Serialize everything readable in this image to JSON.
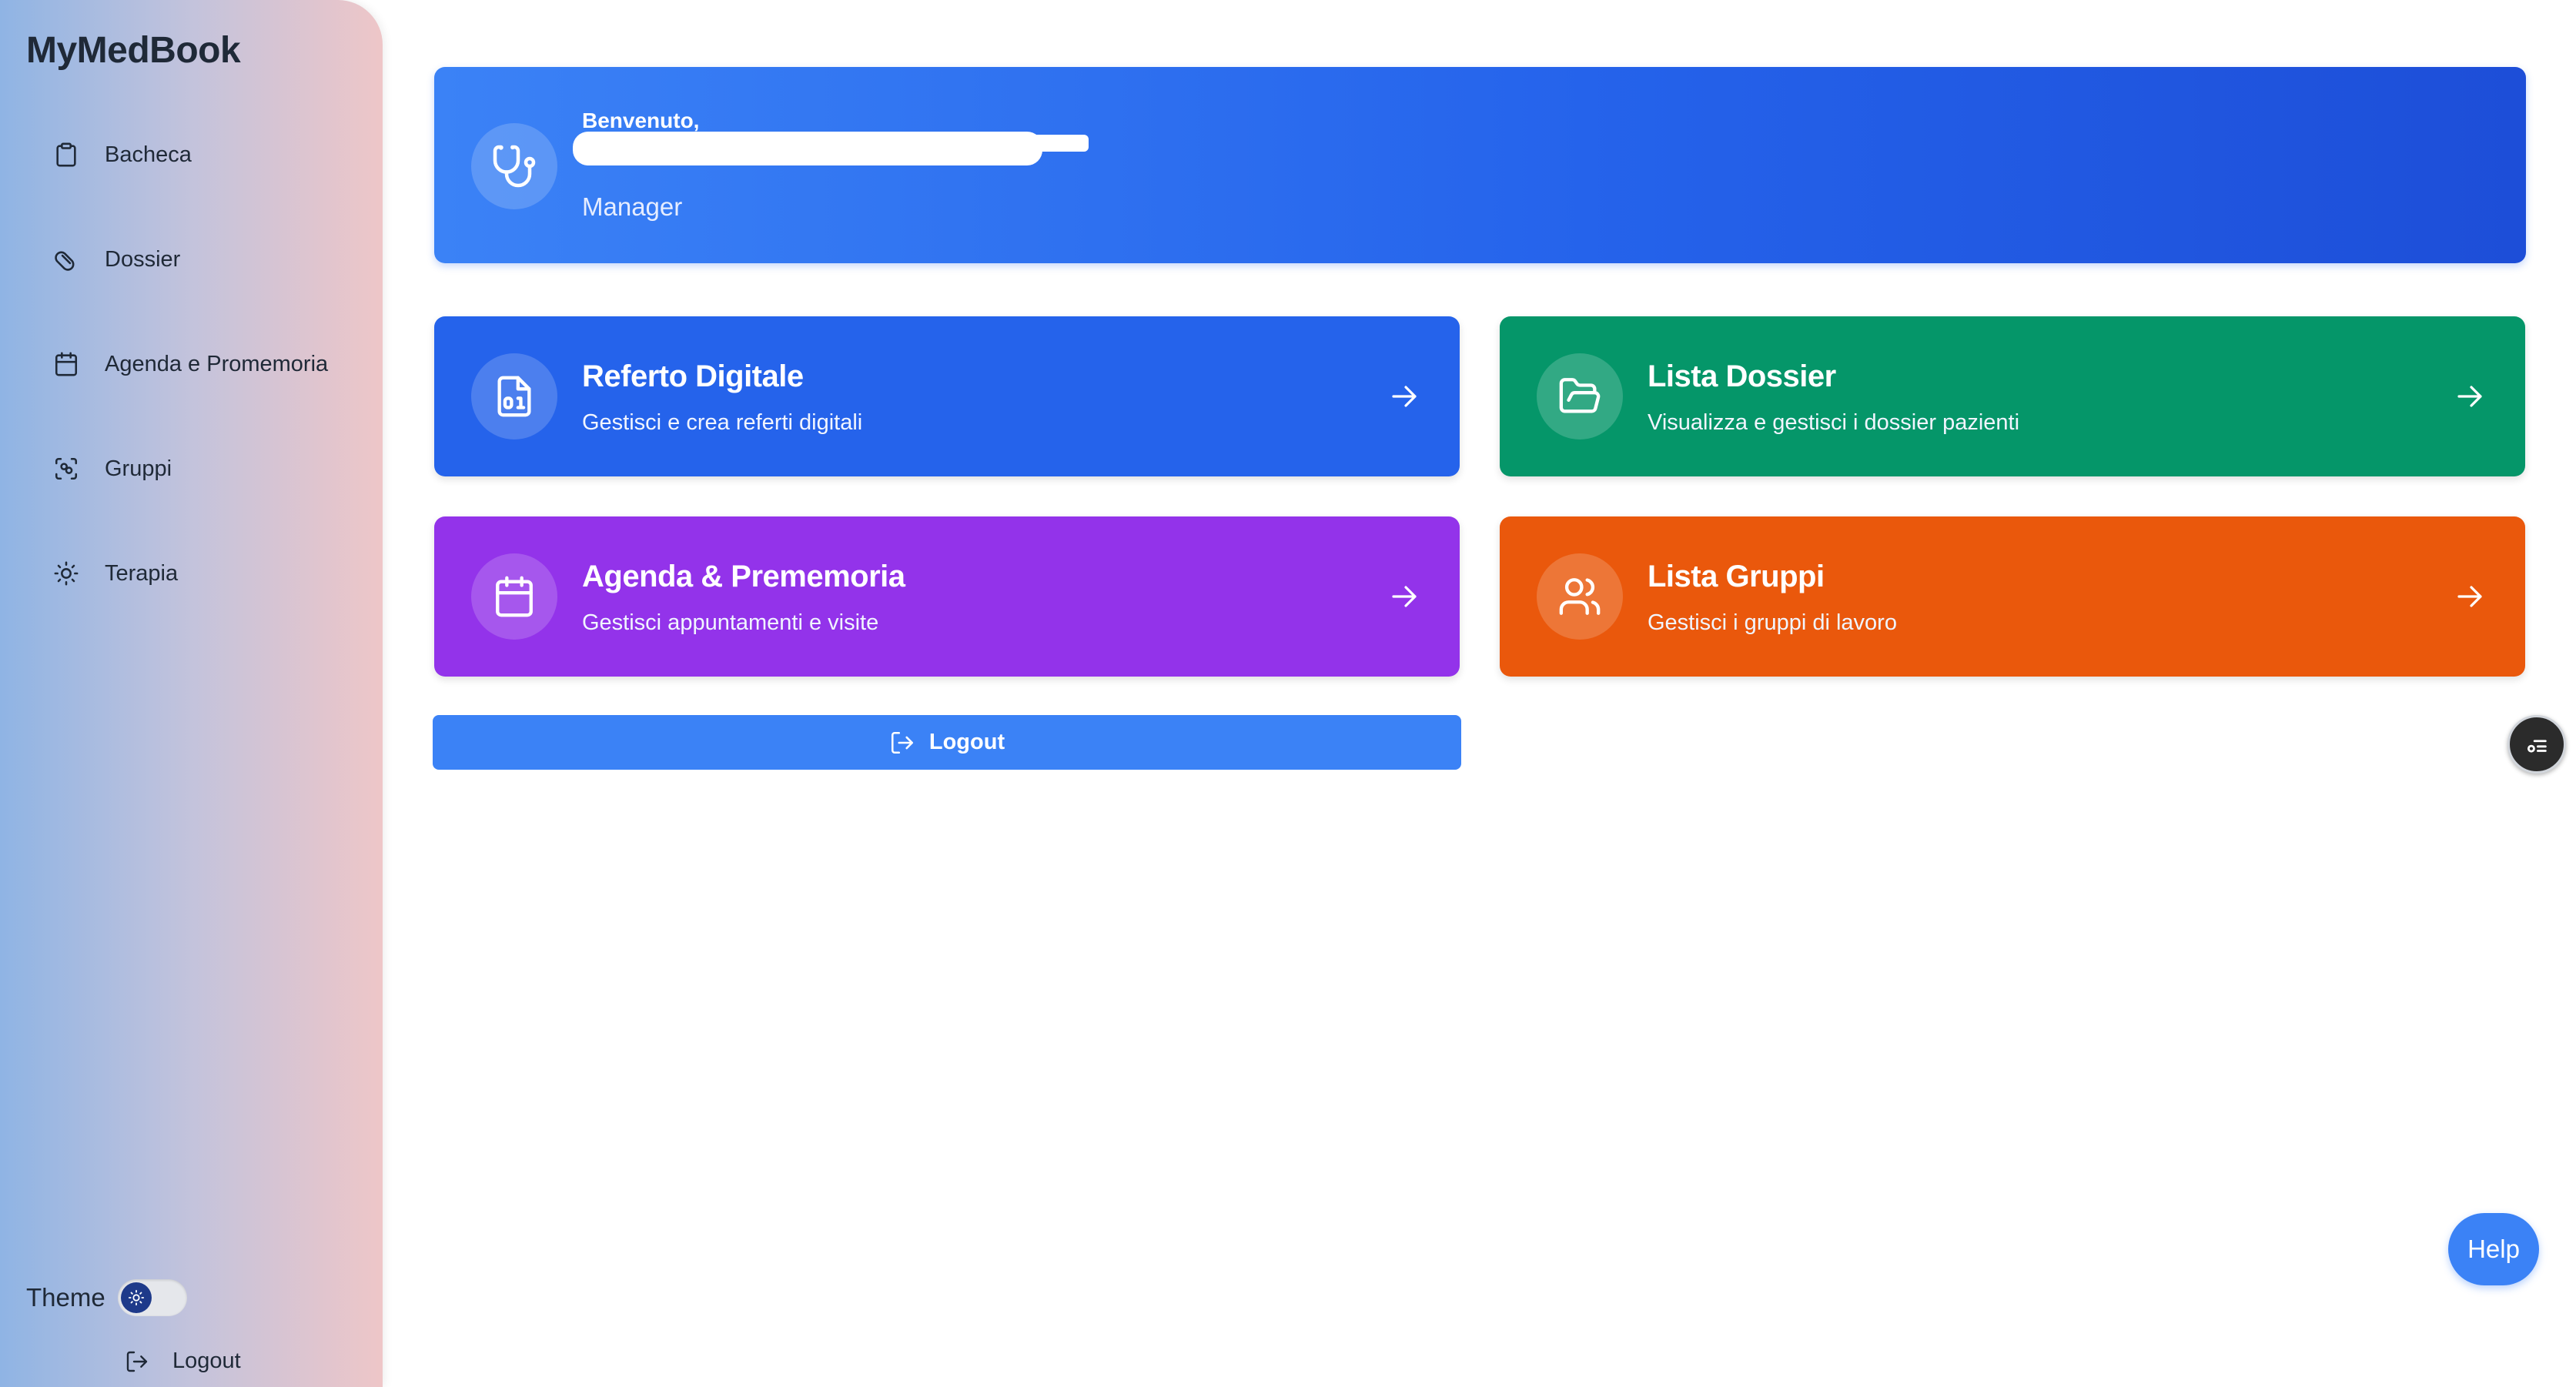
{
  "app": {
    "brand": "MyMedBook"
  },
  "sidebar": {
    "items": [
      {
        "label": "Bacheca",
        "icon": "clipboard-icon"
      },
      {
        "label": "Dossier",
        "icon": "pill-icon"
      },
      {
        "label": "Agenda e Promemoria",
        "icon": "calendar-icon"
      },
      {
        "label": "Gruppi",
        "icon": "scan-group-icon"
      },
      {
        "label": "Terapia",
        "icon": "sun-icon"
      }
    ],
    "theme_label": "Theme",
    "logout_label": "Logout"
  },
  "banner": {
    "greeting": "Benvenuto,",
    "role": "Manager",
    "icon": "stethoscope-icon"
  },
  "cards": [
    {
      "title": "Referto Digitale",
      "subtitle": "Gestisci e crea referti digitali",
      "icon": "file-binary-icon",
      "color": "#2563eb"
    },
    {
      "title": "Lista Dossier",
      "subtitle": "Visualizza e gestisci i dossier pazienti",
      "icon": "folder-open-icon",
      "color": "#059669"
    },
    {
      "title": "Agenda & Prememoria",
      "subtitle": "Gestisci appuntamenti e visite",
      "icon": "calendar-icon",
      "color": "#9333ea"
    },
    {
      "title": "Lista Gruppi",
      "subtitle": "Gestisci i gruppi di lavoro",
      "icon": "users-icon",
      "color": "#ea580c"
    }
  ],
  "main": {
    "logout_label": "Logout"
  },
  "help": {
    "label": "Help"
  },
  "colors": {
    "primary": "#3b82f6",
    "brand_dark": "#1f2937"
  }
}
